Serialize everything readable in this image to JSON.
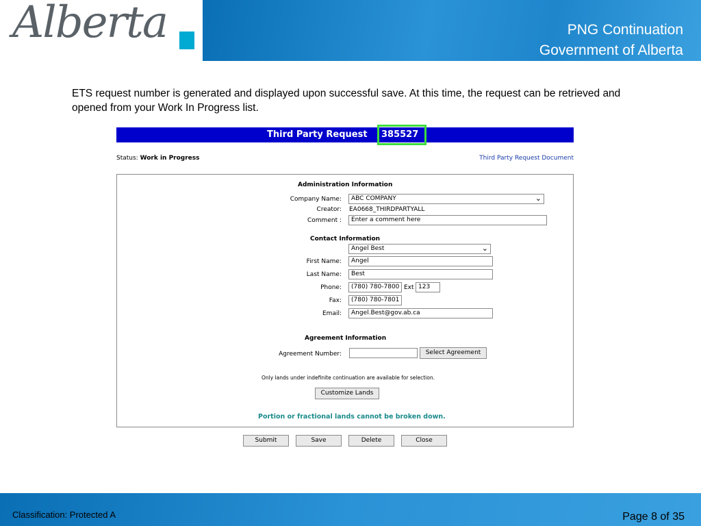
{
  "header": {
    "logo_text": "Alberta",
    "title_line1": "PNG Continuation",
    "title_line2": "Government of Alberta"
  },
  "intro_text": "ETS request number is generated and displayed upon successful save.  At this time, the request can be retrieved and opened from your Work In Progress list.",
  "app": {
    "title": "Third Party Request",
    "request_number": "385527",
    "status_label": "Status:",
    "status_value": "Work in Progress",
    "doc_link": "Third Party Request Document"
  },
  "admin": {
    "heading": "Administration Information",
    "company_label": "Company Name:",
    "company_value": "ABC COMPANY",
    "creator_label": "Creator:",
    "creator_value": "EA0668_THIRDPARTYALL",
    "comment_label": "Comment :",
    "comment_placeholder": "Enter a comment here"
  },
  "contact": {
    "heading": "Contact Information",
    "contact_select": "Angel Best",
    "first_label": "First Name:",
    "first_value": "Angel",
    "last_label": "Last Name:",
    "last_value": "Best",
    "phone_label": "Phone:",
    "phone_value": "(780) 780-7800",
    "ext_label": "Ext",
    "ext_value": "123",
    "fax_label": "Fax:",
    "fax_value": "(780) 780-7801",
    "email_label": "Email:",
    "email_value": "Angel.Best@gov.ab.ca"
  },
  "agreement": {
    "heading": "Agreement Information",
    "number_label": "Agreement Number:",
    "number_value": "",
    "select_button": "Select Agreement",
    "note": "Only lands under indefinite continuation are available for selection.",
    "customize_button": "Customize Lands",
    "warning": "Portion or fractional lands cannot be broken down."
  },
  "actions": {
    "submit": "Submit",
    "save": "Save",
    "delete": "Delete",
    "close": "Close"
  },
  "footer": {
    "classification": "Classification: Protected A",
    "page": "Page 8 of 35"
  },
  "colors": {
    "title_bar": "#0000cc",
    "highlight": "#3ddc3d",
    "banner": "#1f86cc",
    "warning_text": "#1a8a8a"
  }
}
